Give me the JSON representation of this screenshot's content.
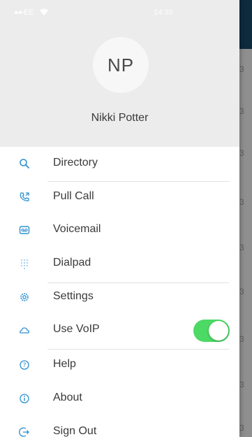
{
  "status_bar": {
    "carrier": "EE",
    "time": "14:35"
  },
  "profile": {
    "initials": "NP",
    "name": "Nikki Potter"
  },
  "menu": {
    "directory": "Directory",
    "pull_call": "Pull Call",
    "voicemail": "Voicemail",
    "dialpad": "Dialpad",
    "settings": "Settings",
    "use_voip": "Use VoIP",
    "help": "Help",
    "about": "About",
    "sign_out": "Sign Out"
  },
  "use_voip_enabled": true,
  "background_digit": "3",
  "colors": {
    "accent": "#2f8fd0",
    "toggle_on": "#4cd964",
    "header_bg": "#ececec"
  }
}
